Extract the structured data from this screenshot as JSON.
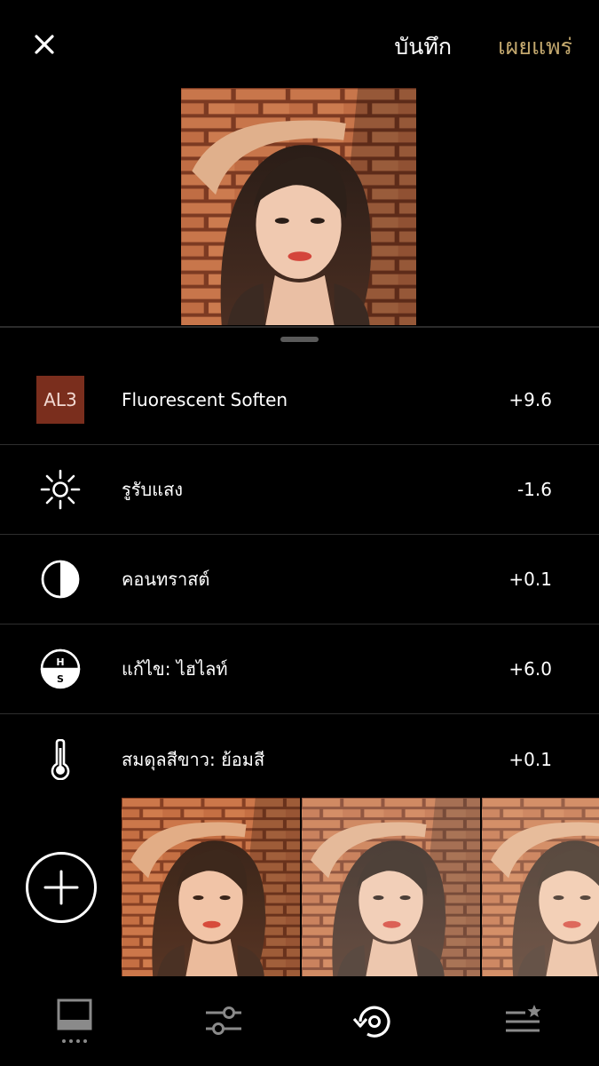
{
  "header": {
    "save_label": "บันทึก",
    "publish_label": "เผยแพร่",
    "publish_color": "#c3a86e"
  },
  "adjustments": [
    {
      "icon": "preset-badge",
      "badge_text": "AL3",
      "label": "Fluorescent Soften",
      "value": "+9.6"
    },
    {
      "icon": "exposure-sun-icon",
      "label": "รูรับแสง",
      "value": "-1.6"
    },
    {
      "icon": "contrast-icon",
      "label": "คอนทราสต์",
      "value": "+0.1"
    },
    {
      "icon": "highlights-shadows-icon",
      "label": "แก้ไข: ไฮไลท์",
      "value": "+6.0"
    },
    {
      "icon": "temperature-thermometer-icon",
      "label": "สมดุลสีขาว: ย้อมสี",
      "value": "+0.1"
    }
  ],
  "thumbnails": [
    {
      "name": "thumbnail-grain-warm"
    },
    {
      "name": "thumbnail-bright"
    },
    {
      "name": "thumbnail-faded"
    }
  ],
  "bottom_nav": [
    {
      "icon": "gallery-icon",
      "active": false
    },
    {
      "icon": "sliders-icon",
      "active": false
    },
    {
      "icon": "history-icon",
      "active": true
    },
    {
      "icon": "recipes-star-icon",
      "active": false
    }
  ],
  "colors": {
    "background": "#000000",
    "accent_gold": "#c3a86e",
    "preset_badge": "#7a2e1d",
    "divider": "#2e2e2e"
  }
}
